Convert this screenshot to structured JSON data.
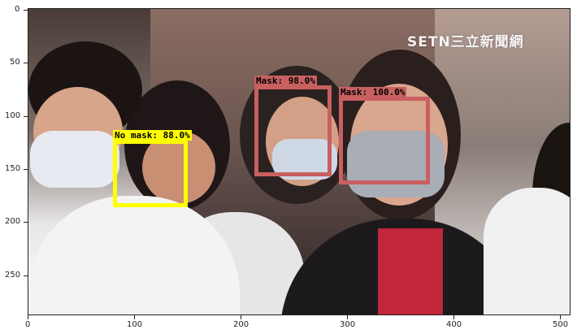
{
  "watermark": "SETN三立新聞網",
  "detections": [
    {
      "label": "No mask: 88.0%",
      "color": "#ffff00"
    },
    {
      "label": "Mask: 98.0%",
      "color": "#c86060"
    },
    {
      "label": "Mask: 100.0%",
      "color": "#c86060"
    }
  ],
  "axes": {
    "y_ticks": [
      "0",
      "50",
      "100",
      "150",
      "200",
      "250"
    ],
    "x_ticks": [
      "0",
      "100",
      "200",
      "300",
      "400",
      "500"
    ]
  }
}
